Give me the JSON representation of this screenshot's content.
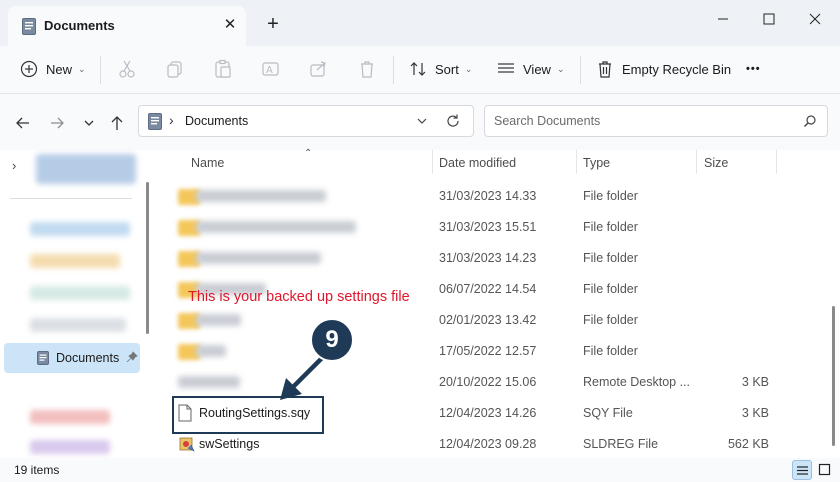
{
  "window": {
    "tab_title": "Documents",
    "tab_close": "✕",
    "tab_add": "+",
    "tab_icon": "documents-folder-icon"
  },
  "toolbar": {
    "new_label": "New",
    "sort_label": "Sort",
    "view_label": "View",
    "empty_recycle_label": "Empty Recycle Bin",
    "more_label": "•••"
  },
  "address": {
    "path_label": "Documents",
    "search_placeholder": "Search Documents"
  },
  "sidebar": {
    "selected_label": "Documents"
  },
  "columns": {
    "name": "Name",
    "date": "Date modified",
    "type": "Type",
    "size": "Size"
  },
  "files": [
    {
      "name": "",
      "date": "31/03/2023 14.33",
      "type": "File folder",
      "size": "",
      "icon": "folder-icon",
      "blurred": true
    },
    {
      "name": "",
      "date": "31/03/2023 15.51",
      "type": "File folder",
      "size": "",
      "icon": "folder-icon",
      "blurred": true
    },
    {
      "name": "",
      "date": "31/03/2023 14.23",
      "type": "File folder",
      "size": "",
      "icon": "folder-icon",
      "blurred": true
    },
    {
      "name": "",
      "date": "06/07/2022 14.54",
      "type": "File folder",
      "size": "",
      "icon": "folder-icon",
      "blurred": true
    },
    {
      "name": "",
      "date": "02/01/2023 13.42",
      "type": "File folder",
      "size": "",
      "icon": "folder-icon",
      "blurred": true
    },
    {
      "name": "",
      "date": "17/05/2022 12.57",
      "type": "File folder",
      "size": "",
      "icon": "folder-icon",
      "blurred": true
    },
    {
      "name": "",
      "date": "20/10/2022 15.06",
      "type": "Remote Desktop ...",
      "size": "3 KB",
      "icon": "remote-desktop-icon",
      "blurred": true
    },
    {
      "name": "RoutingSettings.sqy",
      "date": "12/04/2023 14.26",
      "type": "SQY File",
      "size": "3 KB",
      "icon": "file-icon",
      "blurred": false
    },
    {
      "name": "swSettings",
      "date": "12/04/2023 09.28",
      "type": "SLDREG File",
      "size": "562 KB",
      "icon": "sldreg-icon",
      "blurred": false
    }
  ],
  "annotation": {
    "text": "This is your backed up settings file",
    "step_number": "9",
    "color": "#e0162b",
    "badge_color": "#1f3a56"
  },
  "status": {
    "item_count": "19 items"
  },
  "colors": {
    "accent": "#cce4f7",
    "folder": "#f4c75b"
  }
}
